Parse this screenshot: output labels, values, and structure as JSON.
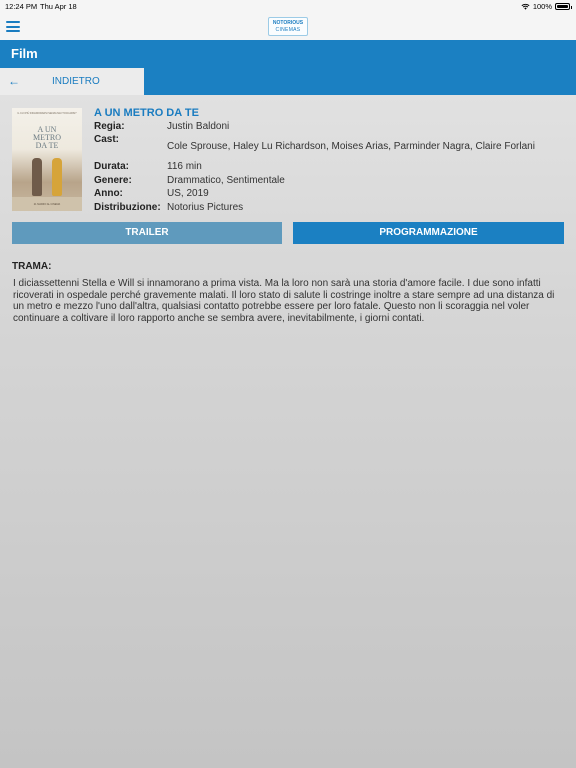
{
  "status_bar": {
    "time": "12:24 PM",
    "date": "Thu Apr 18",
    "battery": "100%"
  },
  "top_bar": {
    "logo_line1": "NOTORIOUS",
    "logo_line2": "CINEMAS"
  },
  "header": {
    "title": "Film",
    "back_label": "INDIETRO"
  },
  "film": {
    "title": "A UN METRO DA TE",
    "poster": {
      "tagline": "IL CUI PIÙ INNAMORARSI SENZA MAI TOCCARSI?",
      "title_line1": "A UN",
      "title_line2": "METRO",
      "title_line3": "DA TE",
      "bottom_text": "21 MARZO AL CINEMA"
    },
    "details": {
      "regia_label": "Regia:",
      "regia": "Justin Baldoni",
      "cast_label": "Cast:",
      "cast": "Cole Sprouse, Haley Lu Richardson, Moises Arias, Parminder Nagra, Claire Forlani",
      "durata_label": "Durata:",
      "durata": "116 min",
      "genere_label": "Genere:",
      "genere": "Drammatico, Sentimentale",
      "anno_label": "Anno:",
      "anno": "US, 2019",
      "distribuzione_label": "Distribuzione:",
      "distribuzione": "Notorius Pictures"
    }
  },
  "buttons": {
    "trailer": "TRAILER",
    "programmazione": "PROGRAMMAZIONE"
  },
  "trama": {
    "label": "TRAMA:",
    "text": "I diciassettenni Stella e Will si innamorano a prima vista. Ma la loro non sarà una storia d'amore facile. I due sono infatti ricoverati in ospedale perché gravemente malati. Il loro stato di salute li costringe inoltre a stare sempre ad una distanza di un metro e mezzo l'uno dall'altra, qualsiasi contatto potrebbe essere per loro fatale. Questo non li scoraggia nel voler continuare a coltivare il loro rapporto anche se sembra avere, inevitabilmente, i giorni contati."
  },
  "colors": {
    "accent": "#1b80c2",
    "trailer_button": "#5f9abd"
  }
}
